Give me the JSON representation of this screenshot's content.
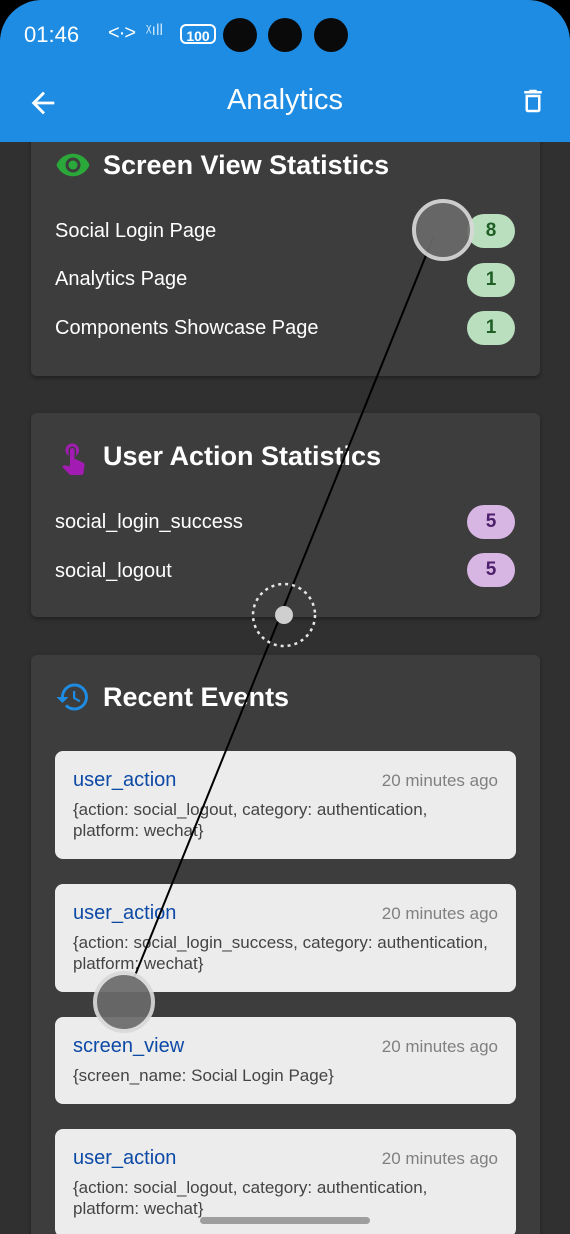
{
  "status_bar": {
    "time": "01:46",
    "network": "<·>",
    "signal": "ᵡıll",
    "battery": "100"
  },
  "app_bar": {
    "title": "Analytics",
    "back_icon": "arrow-back-icon",
    "delete_icon": "trash-icon"
  },
  "screen_views": {
    "title": "Screen View Statistics",
    "icon": "eye-icon",
    "items": [
      {
        "label": "Social Login Page",
        "count": "8"
      },
      {
        "label": "Analytics Page",
        "count": "1"
      },
      {
        "label": "Components Showcase Page",
        "count": "1"
      }
    ]
  },
  "user_actions": {
    "title": "User Action Statistics",
    "icon": "touch-icon",
    "items": [
      {
        "label": "social_login_success",
        "count": "5"
      },
      {
        "label": "social_logout",
        "count": "5"
      }
    ]
  },
  "recent_events": {
    "title": "Recent Events",
    "icon": "history-icon",
    "items": [
      {
        "type": "user_action",
        "time": "20 minutes ago",
        "detail": "{action: social_logout, category: authentication, platform: wechat}"
      },
      {
        "type": "user_action",
        "time": "20 minutes ago",
        "detail": "{action: social_login_success, category: authentication, platform: wechat}"
      },
      {
        "type": "screen_view",
        "time": "20 minutes ago",
        "detail": "{screen_name: Social Login Page}"
      },
      {
        "type": "user_action",
        "time": "20 minutes ago",
        "detail": "{action: social_logout, category: authentication, platform: wechat}"
      }
    ]
  },
  "colors": {
    "app_bar": "#1e8ce3",
    "background": "#303030",
    "card": "#3d3d3d",
    "green_accent": "#2aa83a",
    "purple_accent": "#a21bb2",
    "blue_accent": "#1e8ce3"
  }
}
